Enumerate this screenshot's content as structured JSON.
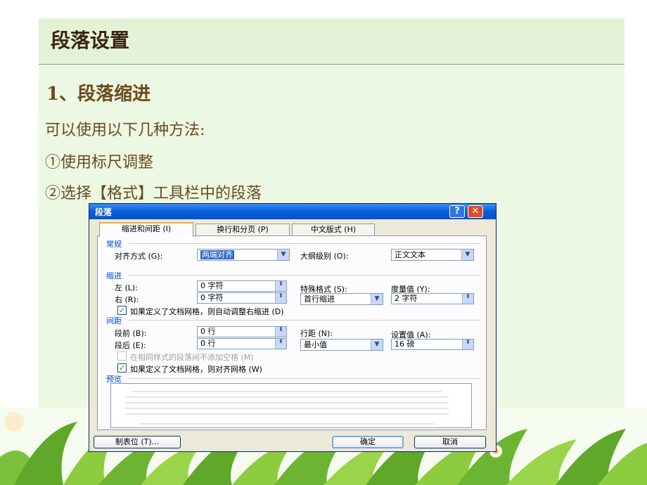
{
  "slide": {
    "title": "段落设置",
    "heading": "1、段落缩进",
    "lines": [
      "可以使用以下几种方法:",
      "①使用标尺调整",
      "②选择【格式】工具栏中的段落"
    ]
  },
  "dialog": {
    "title": "段落",
    "help_glyph": "?",
    "close_glyph": "✕",
    "tabs": [
      "缩进和间距 (I)",
      "换行和分页 (P)",
      "中文版式 (H)"
    ],
    "general": {
      "label": "常规",
      "alignment_label": "对齐方式 (G):",
      "alignment_value": "两端对齐",
      "outline_label": "大纲级别 (O):",
      "outline_value": "正文文本"
    },
    "indent": {
      "label": "缩进",
      "left_label": "左 (L):",
      "left_value": "0 字符",
      "right_label": "右 (R):",
      "right_value": "0 字符",
      "special_label": "特殊格式 (S):",
      "special_value": "首行缩进",
      "by_label": "度量值 (Y):",
      "by_value": "2 字符",
      "auto_adjust_label": "如果定义了文档网格，则自动调整右缩进 (D)",
      "auto_adjust_checked": true
    },
    "spacing": {
      "label": "间距",
      "before_label": "段前 (B):",
      "before_value": "0 行",
      "after_label": "段后 (E):",
      "after_value": "0 行",
      "line_spacing_label": "行距 (N):",
      "line_spacing_value": "最小值",
      "at_label": "设置值 (A):",
      "at_value": "16 磅",
      "no_space_label": "在相同样式的段落间不添加空格 (M)",
      "no_space_checked": false,
      "snap_grid_label": "如果定义了文档网格，则对齐网格 (W)",
      "snap_grid_checked": true
    },
    "preview_label": "预览",
    "buttons": {
      "tabs": "制表位 (T)...",
      "ok": "确定",
      "cancel": "取消"
    },
    "check_glyph": "✓",
    "spin_glyph": "⬍",
    "drop_glyph": "▼"
  },
  "colors": {
    "slide_bg": "#ecf8e3",
    "title_text": "#3a2410",
    "body_text": "#6a4a22",
    "dialog_bg": "#ece9d8",
    "titlebar": "#0a5fd8"
  }
}
